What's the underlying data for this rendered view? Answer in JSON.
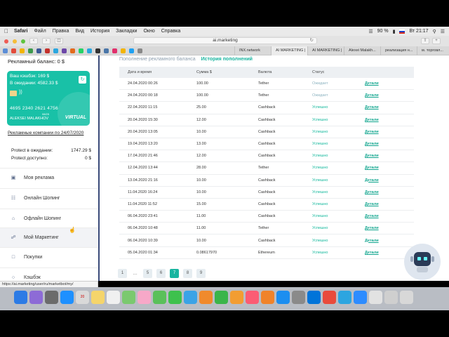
{
  "menubar": {
    "app": "Safari",
    "items": [
      "Файл",
      "Правка",
      "Вид",
      "История",
      "Закладки",
      "Окно",
      "Справка"
    ],
    "battery": "90 %",
    "clock": "Вт 21:17"
  },
  "browser": {
    "url": "ai.marketing",
    "tabs": [
      "INX.network",
      "AI MARKETING |",
      "AI MARKETING |",
      "Alexei Malakh...",
      "реализация н...",
      "м. торговл..."
    ]
  },
  "status_url": "https://ai.marketing/user/ru/marketbot/my/",
  "sidebar": {
    "balance": "Рекламный баланс: 0 $",
    "card": {
      "cashback": "Ваш кэшбэк: 169 $",
      "pending": "В ожидании: 4582.33 $",
      "number": "4695 2340 2621 4756",
      "expiry": "08/25",
      "holder": "ALEKSEI MALAKHOV",
      "brand": "VIRTUAL"
    },
    "campaigns_link": "Рекламные компании по 24/07/2020",
    "protect": [
      {
        "label": "Protect в ожидании:",
        "value": "1747.29 $"
      },
      {
        "label": "Protect доступно:",
        "value": "0 $"
      }
    ],
    "menu": [
      {
        "label": "Моя реклама",
        "icon": "megaphone-icon"
      },
      {
        "label": "Онлайн Шопинг",
        "icon": "cart-icon"
      },
      {
        "label": "Офлайн Шопинг",
        "icon": "store-icon"
      },
      {
        "label": "Мой Маркетинг",
        "icon": "handshake-icon"
      },
      {
        "label": "Покупки",
        "icon": "bag-icon"
      },
      {
        "label": "Кэшбэк",
        "icon": "cashback-icon"
      }
    ]
  },
  "main": {
    "tab_replenish": "Пополнение рекламного баланса",
    "tab_history": "История пополнений",
    "columns": [
      "Дата и время",
      "Сумма $",
      "Валюта",
      "Статус",
      ""
    ],
    "rows": [
      {
        "date": "24.04.2020 00:26",
        "amount": "100.00",
        "currency": "Tether",
        "status": "Ожидает",
        "status_kind": "wait",
        "link": "Детали"
      },
      {
        "date": "24.04.2020 00:18",
        "amount": "100.00",
        "currency": "Tether",
        "status": "Ожидает",
        "status_kind": "wait",
        "link": "Детали"
      },
      {
        "date": "22.04.2020 11:15",
        "amount": "25.00",
        "currency": "Cashback",
        "status": "Успешно",
        "status_kind": "ok",
        "link": "Детали"
      },
      {
        "date": "20.04.2020 15:30",
        "amount": "12.00",
        "currency": "Cashback",
        "status": "Успешно",
        "status_kind": "ok",
        "link": "Детали"
      },
      {
        "date": "20.04.2020 13:05",
        "amount": "10.00",
        "currency": "Cashback",
        "status": "Успешно",
        "status_kind": "ok",
        "link": "Детали"
      },
      {
        "date": "19.04.2020 13:20",
        "amount": "13.00",
        "currency": "Cashback",
        "status": "Успешно",
        "status_kind": "ok",
        "link": "Детали"
      },
      {
        "date": "17.04.2020 21:46",
        "amount": "12.00",
        "currency": "Cashback",
        "status": "Успешно",
        "status_kind": "ok",
        "link": "Детали"
      },
      {
        "date": "12.04.2020 13:44",
        "amount": "28.00",
        "currency": "Tether",
        "status": "Успешно",
        "status_kind": "ok",
        "link": "Детали"
      },
      {
        "date": "13.04.2020 21:16",
        "amount": "10.00",
        "currency": "Cashback",
        "status": "Успешно",
        "status_kind": "ok",
        "link": "Детали"
      },
      {
        "date": "11.04.2020 16:24",
        "amount": "10.00",
        "currency": "Cashback",
        "status": "Успешно",
        "status_kind": "ok",
        "link": "Детали"
      },
      {
        "date": "11.04.2020 11:52",
        "amount": "15.00",
        "currency": "Cashback",
        "status": "Успешно",
        "status_kind": "ok",
        "link": "Детали"
      },
      {
        "date": "06.04.2020 23:41",
        "amount": "11.00",
        "currency": "Cashback",
        "status": "Успешно",
        "status_kind": "ok",
        "link": "Детали"
      },
      {
        "date": "06.04.2020 10:48",
        "amount": "11.00",
        "currency": "Tether",
        "status": "Успешно",
        "status_kind": "ok",
        "link": "Детали"
      },
      {
        "date": "06.04.2020 10:39",
        "amount": "10.00",
        "currency": "Cashback",
        "status": "Успешно",
        "status_kind": "ok",
        "link": "Детали"
      },
      {
        "date": "05.04.2020 01:34",
        "amount": "0.08617970",
        "currency": "Ethereum",
        "status": "Успешно",
        "status_kind": "ok",
        "link": "Детали"
      }
    ],
    "pagination": [
      "1",
      "…",
      "5",
      "6",
      "7",
      "8",
      "9"
    ],
    "active_page": "7"
  },
  "dock_date": "20",
  "colors": {
    "accent": "#19b5a0",
    "card": "#19c1a7",
    "sidebar_border": "#3a4a7a"
  }
}
